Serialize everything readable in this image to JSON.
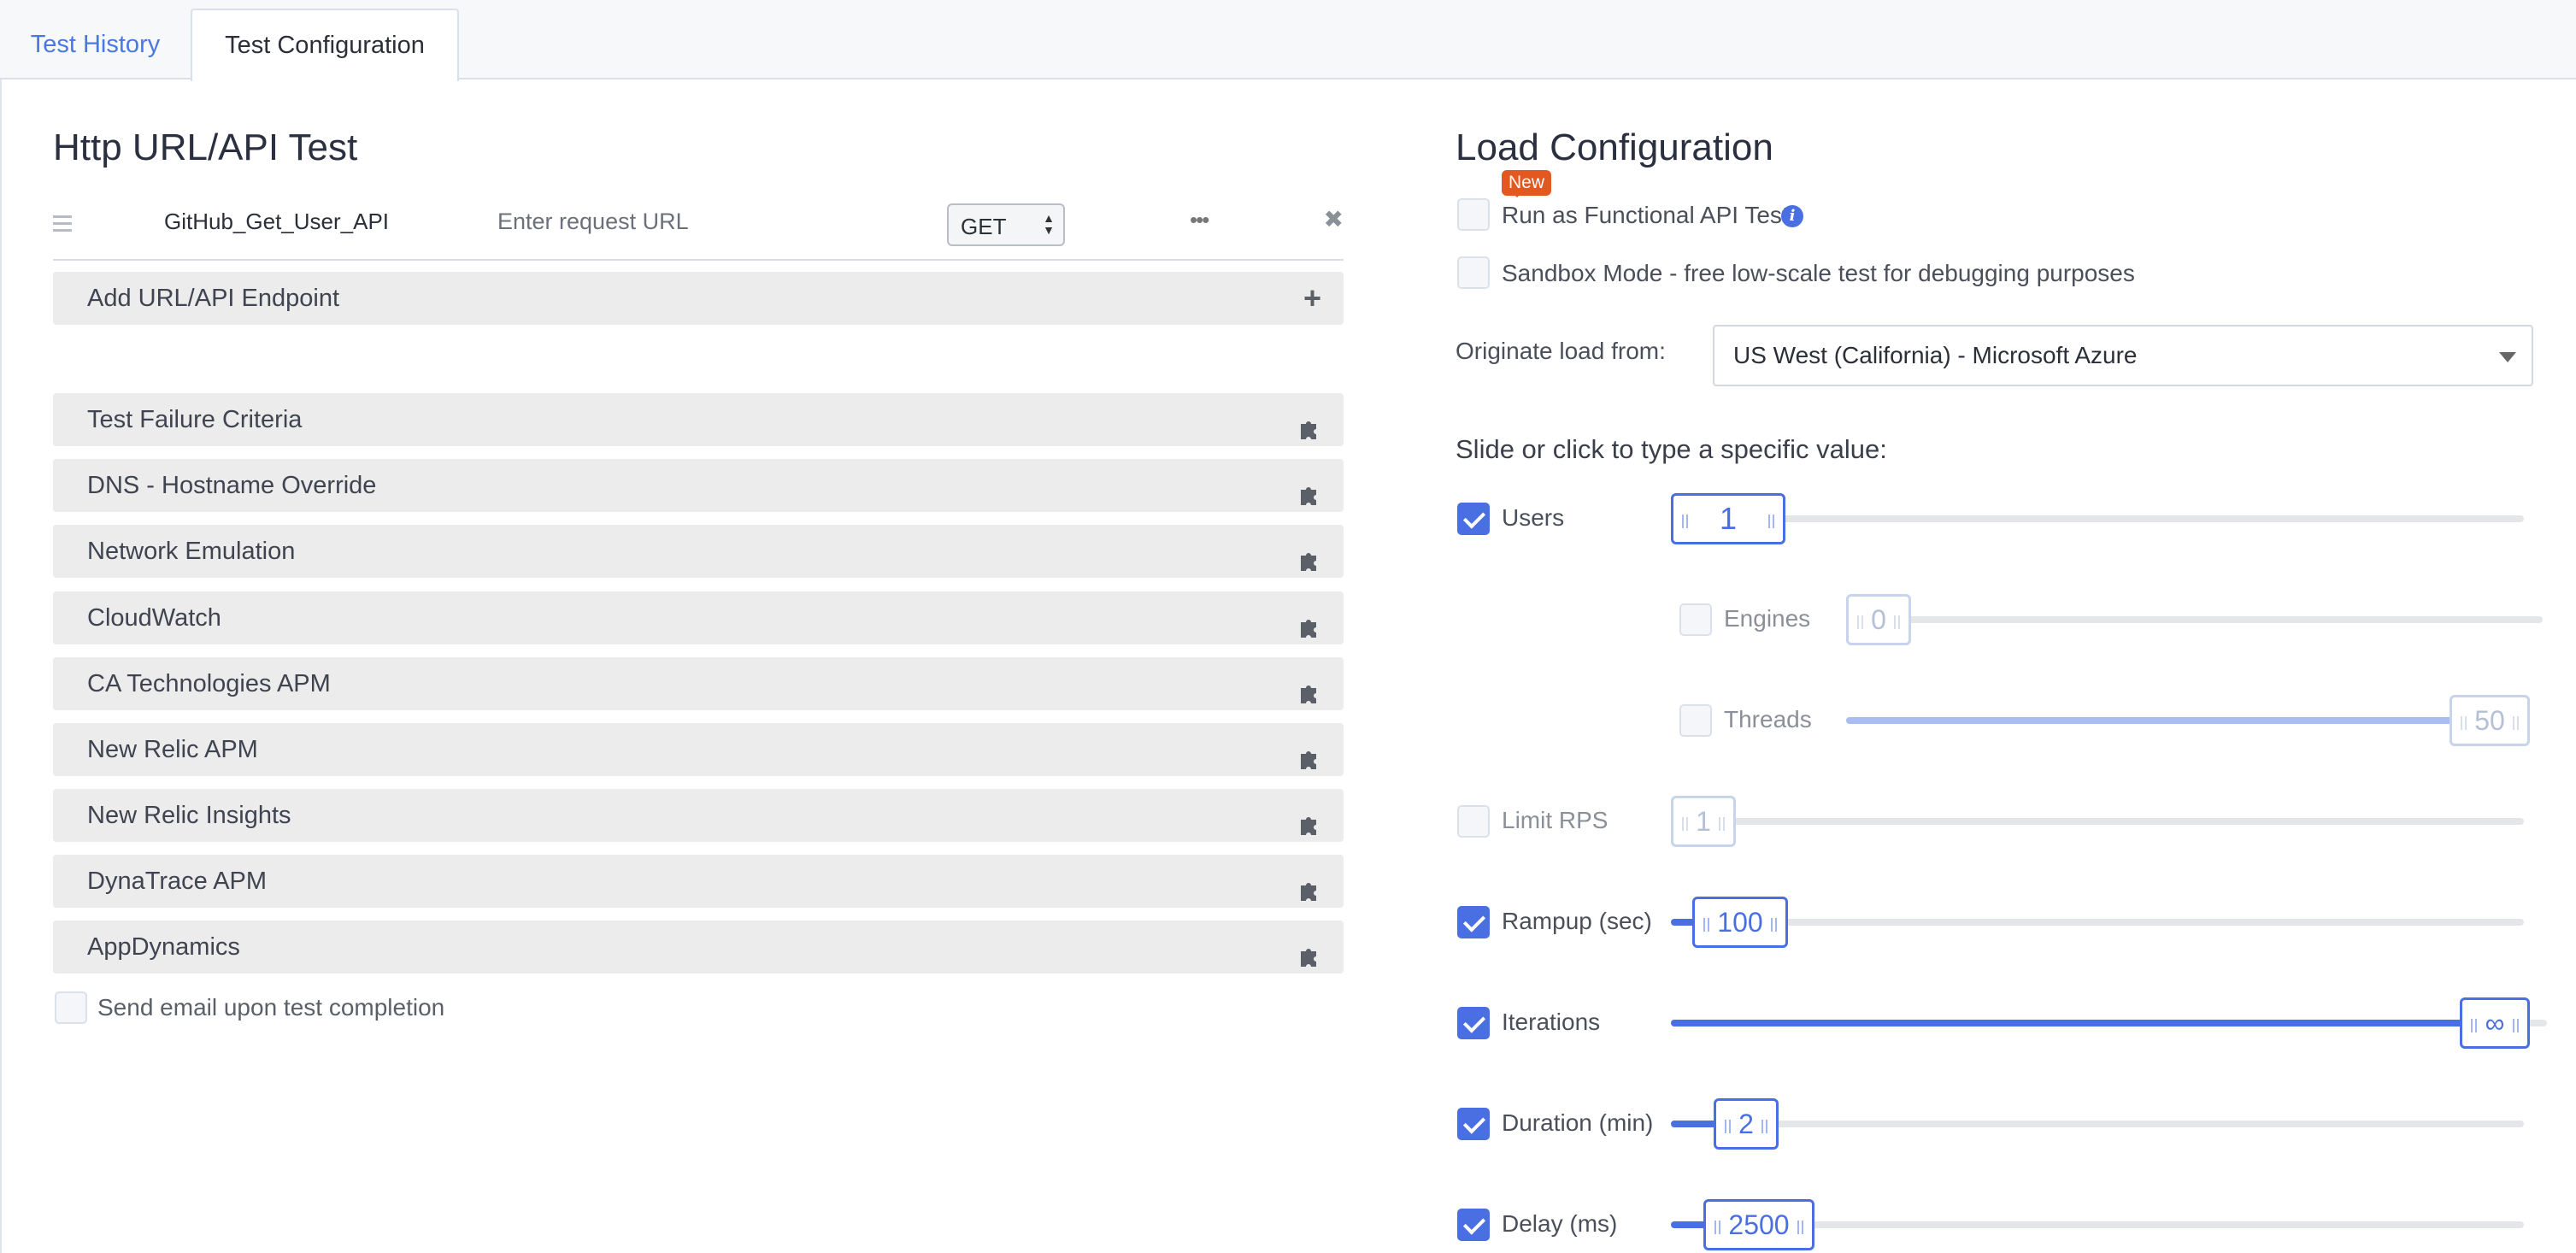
{
  "tabs": [
    {
      "label": "Test History",
      "active": false
    },
    {
      "label": "Test Configuration",
      "active": true
    }
  ],
  "left": {
    "title": "Http URL/API Test",
    "endpoint": {
      "name": "GitHub_Get_User_API",
      "url_placeholder": "Enter request URL",
      "method": "GET",
      "more_label": "•••",
      "close_label": "✖"
    },
    "add_endpoint": "Add URL/API Endpoint",
    "sections": [
      "Test Failure Criteria",
      "DNS - Hostname Override",
      "Network Emulation",
      "CloudWatch",
      "CA Technologies APM",
      "New Relic APM",
      "New Relic Insights",
      "DynaTrace APM",
      "AppDynamics"
    ],
    "email_label": "Send email upon test completion"
  },
  "right": {
    "title": "Load Configuration",
    "new_badge": "New",
    "functional_label": "Run as Functional API Test",
    "sandbox_label": "Sandbox Mode - free low-scale test for debugging purposes",
    "originate_label": "Originate load from:",
    "originate_value": "US West (California) - Microsoft Azure",
    "slide_hint": "Slide or click to type a specific value:",
    "sliders": {
      "users": {
        "label": "Users",
        "value": "1",
        "checked": true,
        "fill_fraction": 0.0
      },
      "engines": {
        "label": "Engines",
        "value": "0",
        "checked": false,
        "fill_fraction": 0.0
      },
      "threads": {
        "label": "Threads",
        "value": "50",
        "checked": false,
        "fill_fraction": 1.0
      },
      "limit_rps": {
        "label": "Limit RPS",
        "value": "1",
        "checked": false,
        "fill_fraction": 0.0
      },
      "rampup": {
        "label": "Rampup (sec)",
        "value": "100",
        "checked": true,
        "fill_fraction": 0.03
      },
      "iterations": {
        "label": "Iterations",
        "value": "∞",
        "checked": true,
        "fill_fraction": 1.0
      },
      "duration": {
        "label": "Duration (min)",
        "value": "2",
        "checked": true,
        "fill_fraction": 0.05
      },
      "delay": {
        "label": "Delay (ms)",
        "value": "2500",
        "checked": true,
        "fill_fraction": 0.04
      }
    }
  },
  "colors": {
    "accent": "#4a6fe3",
    "badge": "#e2581f",
    "tab_link": "#4a78e0"
  }
}
